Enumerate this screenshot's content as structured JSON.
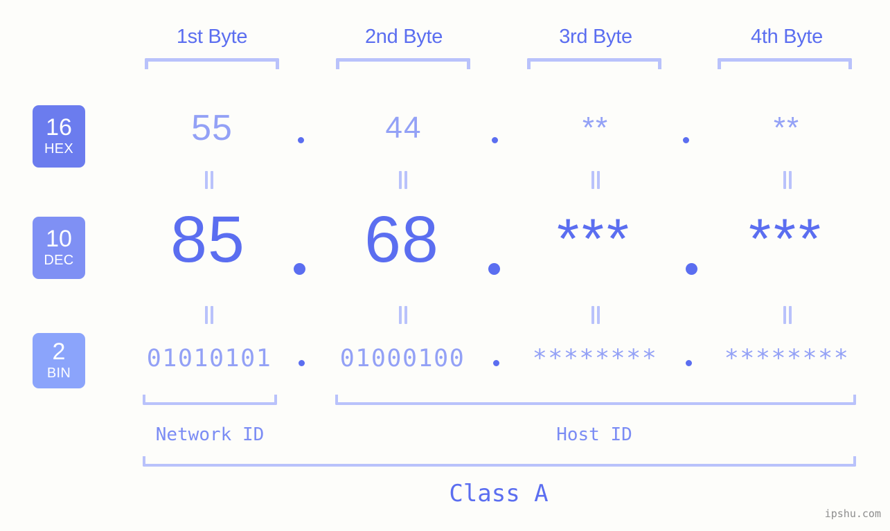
{
  "background_color": "#fdfdfa",
  "accent_colors": {
    "strong": "#5b6ef0",
    "mid": "#7f90f4",
    "light": "#93a1f6",
    "bracket": "#b9c2fb",
    "badge_hex": "#6b7cee",
    "badge_dec": "#7f90f4",
    "badge_bin": "#8ba4fb",
    "watermark": "#8d8d8d"
  },
  "byte_headers": [
    {
      "label": "1st Byte"
    },
    {
      "label": "2nd Byte"
    },
    {
      "label": "3rd Byte"
    },
    {
      "label": "4th Byte"
    }
  ],
  "radix_badges": [
    {
      "number": "16",
      "name": "HEX"
    },
    {
      "number": "10",
      "name": "DEC"
    },
    {
      "number": "2",
      "name": "BIN"
    }
  ],
  "rows": {
    "hex": {
      "values": [
        "55",
        "44",
        "**",
        "**"
      ]
    },
    "dec": {
      "values": [
        "85",
        "68",
        "***",
        "***"
      ]
    },
    "bin": {
      "values": [
        "01010101",
        "01000100",
        "********",
        "********"
      ]
    }
  },
  "separators": {
    "hex": [
      ".",
      ".",
      "."
    ],
    "dec": [
      ".",
      ".",
      "."
    ],
    "bin": [
      ".",
      ".",
      "."
    ]
  },
  "equals_connector": "=",
  "id_sections": [
    {
      "label": "Network ID"
    },
    {
      "label": "Host ID"
    }
  ],
  "class_label": "Class A",
  "watermark": "ipshu.com"
}
